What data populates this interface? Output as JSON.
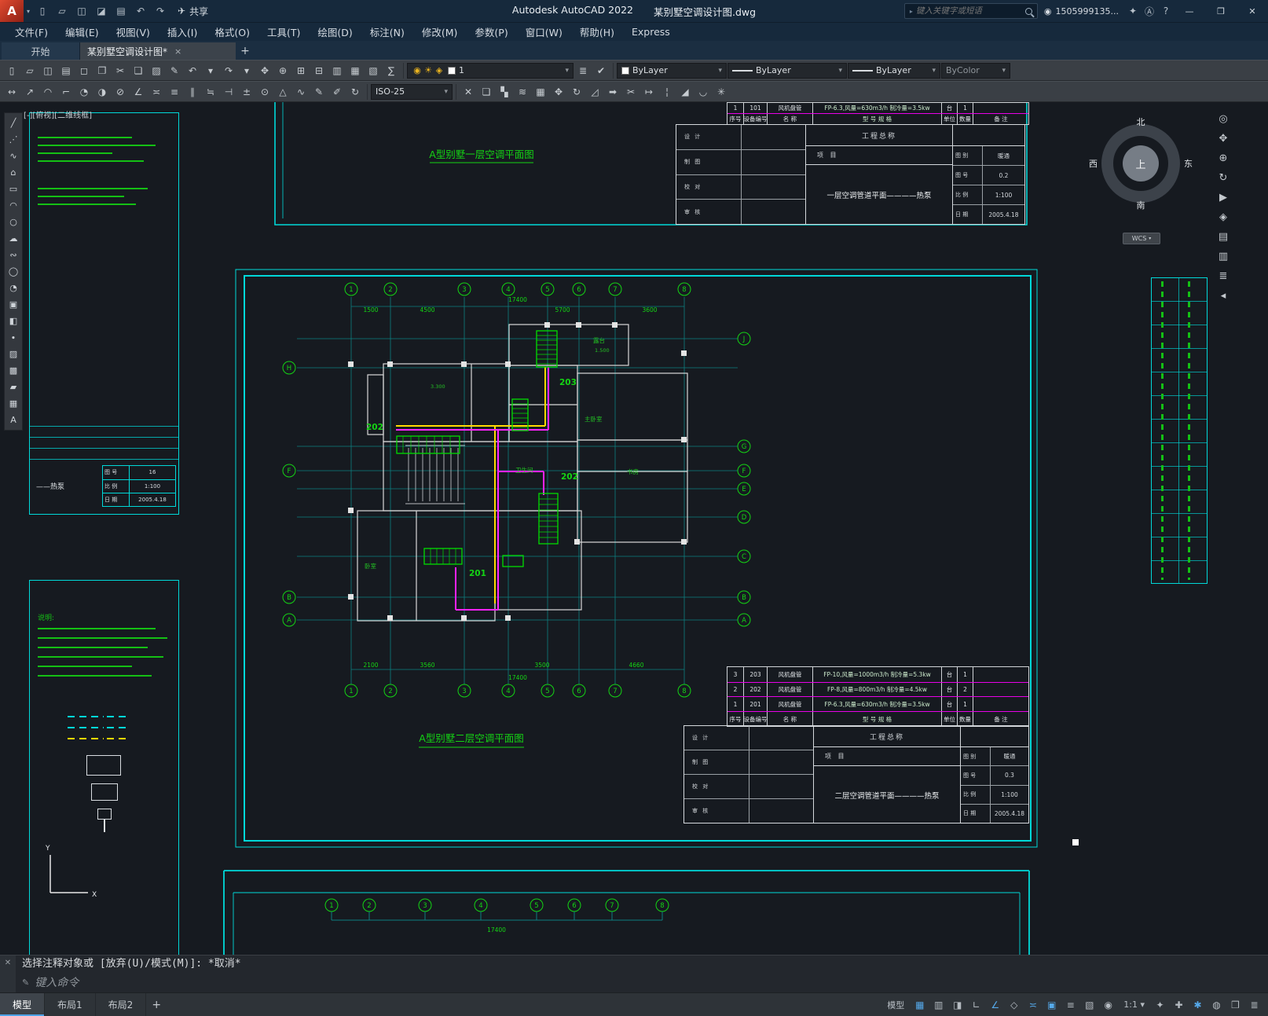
{
  "titlebar": {
    "logo_letter": "A",
    "quick_icons": [
      {
        "name": "qnew-icon",
        "glyph": "▯"
      },
      {
        "name": "open-icon",
        "glyph": "▱"
      },
      {
        "name": "save-icon",
        "glyph": "◫"
      },
      {
        "name": "saveas-icon",
        "glyph": "◪"
      },
      {
        "name": "plot-icon",
        "glyph": "▤"
      },
      {
        "name": "undo-icon",
        "glyph": "↶"
      },
      {
        "name": "redo-icon",
        "glyph": "↷"
      }
    ],
    "share_icon": "✈",
    "share_label": "共享",
    "app_name": "Autodesk AutoCAD 2022",
    "doc_name": "某别墅空调设计图.dwg",
    "search_placeholder": "键入关键字或短语",
    "avatar_glyph": "◉",
    "account_label": "1505999135...",
    "post_icons": [
      {
        "name": "cart-icon",
        "glyph": "✦"
      },
      {
        "name": "autodesk-app-icon",
        "glyph": "Ⓐ"
      },
      {
        "name": "help-icon",
        "glyph": "?"
      }
    ],
    "window_min": "—",
    "window_max": "❒",
    "window_close": "✕"
  },
  "menubar": {
    "items": [
      "文件(F)",
      "编辑(E)",
      "视图(V)",
      "插入(I)",
      "格式(O)",
      "工具(T)",
      "绘图(D)",
      "标注(N)",
      "修改(M)",
      "参数(P)",
      "窗口(W)",
      "帮助(H)",
      "Express"
    ]
  },
  "tabbar": {
    "start_label": "开始",
    "doc_label": "某别墅空调设计图*",
    "close_glyph": "×",
    "add_glyph": "+"
  },
  "toolbar1": {
    "icons": [
      {
        "name": "qnew-icon",
        "glyph": "▯"
      },
      {
        "name": "open-icon",
        "glyph": "▱"
      },
      {
        "name": "save-icon",
        "glyph": "◫"
      },
      {
        "name": "plot-icon",
        "glyph": "▤"
      },
      {
        "name": "plot-preview-icon",
        "glyph": "◻"
      },
      {
        "name": "publish-icon",
        "glyph": "❐"
      },
      {
        "name": "cut-icon",
        "glyph": "✂"
      },
      {
        "name": "copy-icon",
        "glyph": "❏"
      },
      {
        "name": "paste-icon",
        "glyph": "▨"
      },
      {
        "name": "match-properties-icon",
        "glyph": "✎"
      },
      {
        "name": "undo-icon",
        "glyph": "↶"
      },
      {
        "name": "undo-list-icon",
        "glyph": "▾"
      },
      {
        "name": "redo-icon",
        "glyph": "↷"
      },
      {
        "name": "redo-list-icon",
        "glyph": "▾"
      },
      {
        "name": "pan-icon",
        "glyph": "✥"
      },
      {
        "name": "zoom-realtime-icon",
        "glyph": "⊕"
      },
      {
        "name": "zoom-window-icon",
        "glyph": "⊞"
      },
      {
        "name": "zoom-previous-icon",
        "glyph": "⊟"
      },
      {
        "name": "properties-icon",
        "glyph": "▥"
      },
      {
        "name": "designcenter-icon",
        "glyph": "▦"
      },
      {
        "name": "tool-palettes-icon",
        "glyph": "▧"
      },
      {
        "name": "quickcalc-icon",
        "glyph": "∑"
      }
    ],
    "layer_toggles": [
      {
        "name": "layer-on-icon",
        "glyph": "◉"
      },
      {
        "name": "layer-freeze-icon",
        "glyph": "☀"
      },
      {
        "name": "layer-lock-icon",
        "glyph": "◈"
      }
    ],
    "layer_value": "1",
    "post_icons": [
      {
        "name": "layer-properties-icon",
        "glyph": "≣"
      },
      {
        "name": "make-object-layer-current-icon",
        "glyph": "✔"
      }
    ],
    "color_value": "ByLayer",
    "linetype_value": "ByLayer",
    "lineweight_value": "ByLayer",
    "plotstyle_value": "ByColor"
  },
  "toolbar2": {
    "icons_left": [
      {
        "name": "dim-linear-icon",
        "glyph": "↔"
      },
      {
        "name": "dim-aligned-icon",
        "glyph": "↗"
      },
      {
        "name": "dim-arc-length-icon",
        "glyph": "◠"
      },
      {
        "name": "dim-ordinate-icon",
        "glyph": "⌐"
      },
      {
        "name": "dim-radius-icon",
        "glyph": "◔"
      },
      {
        "name": "dim-jogged-icon",
        "glyph": "◑"
      },
      {
        "name": "dim-diameter-icon",
        "glyph": "⊘"
      },
      {
        "name": "dim-angular-icon",
        "glyph": "∠"
      },
      {
        "name": "quick-dim-icon",
        "glyph": "≍"
      },
      {
        "name": "dim-baseline-icon",
        "glyph": "≡"
      },
      {
        "name": "dim-continue-icon",
        "glyph": "∥"
      },
      {
        "name": "dim-space-icon",
        "glyph": "≒"
      },
      {
        "name": "dim-break-icon",
        "glyph": "⊣"
      },
      {
        "name": "tolerance-icon",
        "glyph": "±"
      },
      {
        "name": "center-mark-icon",
        "glyph": "⊙"
      },
      {
        "name": "dim-inspect-icon",
        "glyph": "△"
      },
      {
        "name": "dim-jogline-icon",
        "glyph": "∿"
      },
      {
        "name": "dim-edit-icon",
        "glyph": "✎"
      },
      {
        "name": "dim-text-edit-icon",
        "glyph": "✐"
      },
      {
        "name": "dim-update-icon",
        "glyph": "↻"
      }
    ],
    "dimstyle_value": "ISO-25",
    "icons_right": [
      {
        "name": "erase-icon",
        "glyph": "✕"
      },
      {
        "name": "copy-object-icon",
        "glyph": "❏"
      },
      {
        "name": "mirror-icon",
        "glyph": "▚"
      },
      {
        "name": "offset-icon",
        "glyph": "≋"
      },
      {
        "name": "array-icon",
        "glyph": "▦"
      },
      {
        "name": "move-icon",
        "glyph": "✥"
      },
      {
        "name": "rotate-icon",
        "glyph": "↻"
      },
      {
        "name": "scale-icon",
        "glyph": "◿"
      },
      {
        "name": "stretch-icon",
        "glyph": "➡"
      },
      {
        "name": "trim-icon",
        "glyph": "✂"
      },
      {
        "name": "extend-icon",
        "glyph": "↦"
      },
      {
        "name": "break-icon",
        "glyph": "¦"
      },
      {
        "name": "chamfer-icon",
        "glyph": "◢"
      },
      {
        "name": "fillet-icon",
        "glyph": "◡"
      },
      {
        "name": "explode-icon",
        "glyph": "✳"
      }
    ]
  },
  "left_palette": {
    "icons": [
      {
        "name": "line-tool-icon",
        "glyph": "╱"
      },
      {
        "name": "construction-line-icon",
        "glyph": "⋰"
      },
      {
        "name": "polyline-tool-icon",
        "glyph": "∿"
      },
      {
        "name": "polygon-tool-icon",
        "glyph": "⌂"
      },
      {
        "name": "rectangle-tool-icon",
        "glyph": "▭"
      },
      {
        "name": "arc-tool-icon",
        "glyph": "◠"
      },
      {
        "name": "circle-tool-icon",
        "glyph": "○"
      },
      {
        "name": "revision-cloud-icon",
        "glyph": "☁"
      },
      {
        "name": "spline-tool-icon",
        "glyph": "∾"
      },
      {
        "name": "ellipse-tool-icon",
        "glyph": "◯"
      },
      {
        "name": "ellipse-arc-icon",
        "glyph": "◔"
      },
      {
        "name": "insert-block-icon",
        "glyph": "▣"
      },
      {
        "name": "create-block-icon",
        "glyph": "◧"
      },
      {
        "name": "point-tool-icon",
        "glyph": "∙"
      },
      {
        "name": "hatch-tool-icon",
        "glyph": "▨"
      },
      {
        "name": "gradient-tool-icon",
        "glyph": "▩"
      },
      {
        "name": "region-tool-icon",
        "glyph": "▰"
      },
      {
        "name": "table-tool-icon",
        "glyph": "▦"
      },
      {
        "name": "mtext-tool-icon",
        "glyph": "A"
      }
    ]
  },
  "right_strip": {
    "icons": [
      {
        "name": "navigation-wheel-icon",
        "glyph": "◎"
      },
      {
        "name": "pan-hand-icon",
        "glyph": "✥"
      },
      {
        "name": "zoom-extents-icon",
        "glyph": "⊕"
      },
      {
        "name": "orbit-icon",
        "glyph": "↻"
      },
      {
        "name": "show-motion-icon",
        "glyph": "▶"
      },
      {
        "name": "anchor-icon",
        "glyph": "◈"
      },
      {
        "name": "sheetset-icon",
        "glyph": "▤"
      },
      {
        "name": "palette-icon",
        "glyph": "▥"
      },
      {
        "name": "list-icon",
        "glyph": "≣"
      },
      {
        "name": "collapse-icon",
        "glyph": "◂"
      }
    ]
  },
  "viewport_controls": "[-][俯视][二维线框]",
  "compass": {
    "north": "北",
    "south": "南",
    "west": "西",
    "east": "东",
    "up": "上"
  },
  "wcs_label": "WCS",
  "canvas": {
    "plan1_title": "A型别墅一层空调平面图",
    "plan2_title": "A型别墅二层空调平面图",
    "grid_numbers": [
      "1",
      "2",
      "3",
      "4",
      "5",
      "6",
      "7",
      "8"
    ],
    "axis_left": [
      "H",
      "F",
      "B",
      "A"
    ],
    "axis_right": [
      "J",
      "G",
      "F",
      "E",
      "D",
      "C",
      "B",
      "A"
    ],
    "top_dims": [
      "1500",
      "4500",
      "5700",
      "3600"
    ],
    "bottom_dims": [
      "2100",
      "3560",
      "3500",
      "4660"
    ],
    "total_dim": "17400",
    "callouts": [
      "203",
      "202",
      "202",
      "201"
    ],
    "levels": [
      "3.300",
      "1.500"
    ],
    "rooms": [
      "主卧室",
      "书房",
      "卫生间",
      "卧室",
      "露台"
    ],
    "ucs_x": "X",
    "ucs_y": "Y",
    "eq_header": [
      "序号",
      "设备编号",
      "名  称",
      "型 号  规 格",
      "单位",
      "数量",
      "备  注"
    ],
    "eq_table1_row": [
      "1",
      "101",
      "风机盘管",
      "FP-6.3,风量=630m3/h 制冷量=3.5kw",
      "台",
      "1",
      ""
    ],
    "eq_table2_rows": [
      [
        "3",
        "203",
        "风机盘管",
        "FP-10,风量=1000m3/h 制冷量=5.3kw",
        "台",
        "1",
        ""
      ],
      [
        "2",
        "202",
        "风机盘管",
        "FP-8,风量=800m3/h 制冷量=4.5kw",
        "台",
        "2",
        ""
      ],
      [
        "1",
        "201",
        "风机盘管",
        "FP-6.3,风量=630m3/h 制冷量=3.5kw",
        "台",
        "1",
        ""
      ]
    ],
    "tb1": {
      "project": "工程总称",
      "item": "项  目",
      "roles": [
        "设 计",
        "制 图",
        "校 对",
        "审 核"
      ],
      "title": "一层空调管道平面————热泵",
      "fields": [
        [
          "图 别",
          "暖通"
        ],
        [
          "图 号",
          "0.2"
        ],
        [
          "比 例",
          "1:100"
        ],
        [
          "日 期",
          "2005.4.18"
        ]
      ]
    },
    "tb2": {
      "project": "工程总称",
      "item": "项  目",
      "roles": [
        "设 计",
        "制 图",
        "校 对",
        "审 核"
      ],
      "title": "二层空调管道平面————热泵",
      "fields": [
        [
          "图 别",
          "暖通"
        ],
        [
          "图 号",
          "0.3"
        ],
        [
          "比 例",
          "1:100"
        ],
        [
          "日 期",
          "2005.4.18"
        ]
      ]
    },
    "lp1": {
      "title_fragment": "——热泵",
      "rows": [
        [
          "图 号",
          "16"
        ],
        [
          "比 例",
          "1:100"
        ],
        [
          "日 期",
          "2005.4.18"
        ]
      ]
    },
    "lp2": {
      "notes_label": "说明:"
    }
  },
  "cmdline": {
    "close_glyph": "✕",
    "history": "选择注释对象或 [放弃(U)/模式(M)]: *取消*",
    "input_icon": "✎",
    "prompt_placeholder": "键入命令"
  },
  "statusbar": {
    "model_tabs": [
      {
        "name": "model-tab",
        "label": "模型",
        "active": true
      },
      {
        "name": "layout1-tab",
        "label": "布局1"
      },
      {
        "name": "layout2-tab",
        "label": "布局2"
      }
    ],
    "add_tab_glyph": "+",
    "right": [
      {
        "name": "model-space-button",
        "glyph": "模型",
        "wide": true
      },
      {
        "name": "grid-icon",
        "glyph": "▦",
        "active": true
      },
      {
        "name": "snap-icon",
        "glyph": "▥"
      },
      {
        "name": "infer-constraints-icon",
        "glyph": "◨"
      },
      {
        "name": "ortho-icon",
        "glyph": "∟"
      },
      {
        "name": "polar-tracking-icon",
        "glyph": "∠",
        "active": true
      },
      {
        "name": "isodraft-icon",
        "glyph": "◇"
      },
      {
        "name": "object-snap-tracking-icon",
        "glyph": "≍",
        "active": true
      },
      {
        "name": "object-snap-icon",
        "glyph": "▣",
        "active": true
      },
      {
        "name": "lineweight-display-icon",
        "glyph": "≡"
      },
      {
        "name": "transparency-icon",
        "glyph": "▧"
      },
      {
        "name": "selection-cycling-icon",
        "glyph": "◉"
      },
      {
        "name": "annotation-scale-button",
        "glyph": "1:1 ▾",
        "wide": true
      },
      {
        "name": "annotation-visibility-icon",
        "glyph": "✦"
      },
      {
        "name": "autoscale-icon",
        "glyph": "✚"
      },
      {
        "name": "workspace-gear-icon",
        "glyph": "✱",
        "active": true
      },
      {
        "name": "annotation-monitor-icon",
        "glyph": "◍"
      },
      {
        "name": "clean-screen-icon",
        "glyph": "❒"
      },
      {
        "name": "customize-icon",
        "glyph": "≣"
      }
    ]
  }
}
